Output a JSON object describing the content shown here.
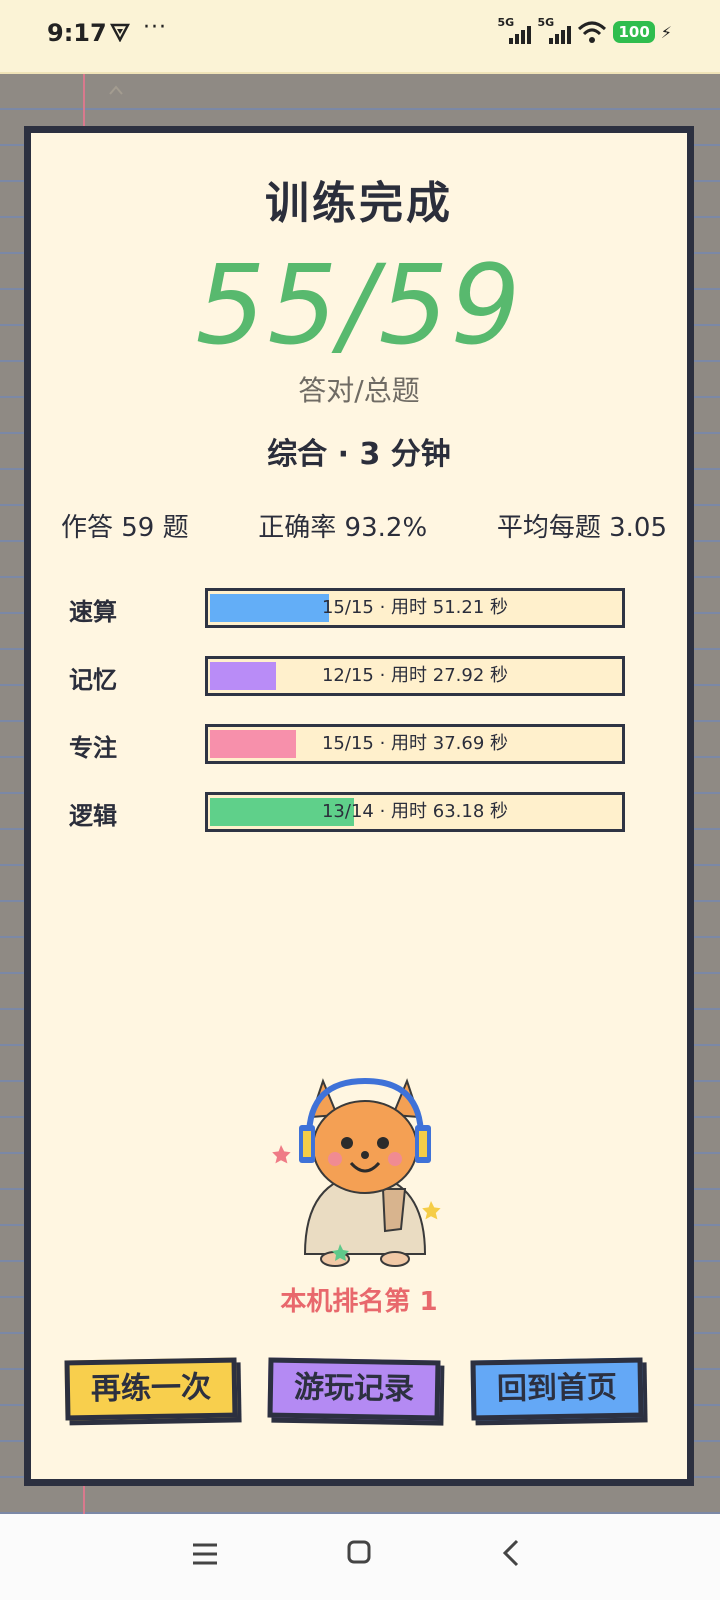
{
  "status_bar": {
    "time": "9:17",
    "dots": "···",
    "signal1_label": "5G",
    "signal2_label": "5G",
    "battery": "100",
    "icons": [
      "vpn-icon",
      "signal-icon",
      "wifi-icon",
      "battery-icon",
      "charging-icon"
    ]
  },
  "result": {
    "title": "训练完成",
    "score": "55/59",
    "score_label": "答对/总题",
    "mode": "综合 · 3 分钟",
    "stats": {
      "answered": "作答 59 题",
      "accuracy": "正确率 93.2%",
      "avg": "平均每题 3.05"
    },
    "categories": [
      {
        "name": "速算",
        "text": "15/15 · 用时 51.21 秒",
        "fill_fraction": 0.29,
        "color": "#63aef7"
      },
      {
        "name": "记忆",
        "text": "12/15 · 用时 27.92 秒",
        "fill_fraction": 0.16,
        "color": "#b98cf7"
      },
      {
        "name": "专注",
        "text": "15/15 · 用时 37.69 秒",
        "fill_fraction": 0.21,
        "color": "#f790ab"
      },
      {
        "name": "逻辑",
        "text": "13/14 · 用时 63.18 秒",
        "fill_fraction": 0.35,
        "color": "#5fd08a"
      }
    ],
    "rank": "本机排名第 1"
  },
  "buttons": {
    "retry": "再练一次",
    "history": "游玩记录",
    "home": "回到首页"
  },
  "colors": {
    "score": "#58b96e",
    "card_bg": "#fff6e1",
    "border": "#2c3040",
    "rank": "#e8686c"
  }
}
